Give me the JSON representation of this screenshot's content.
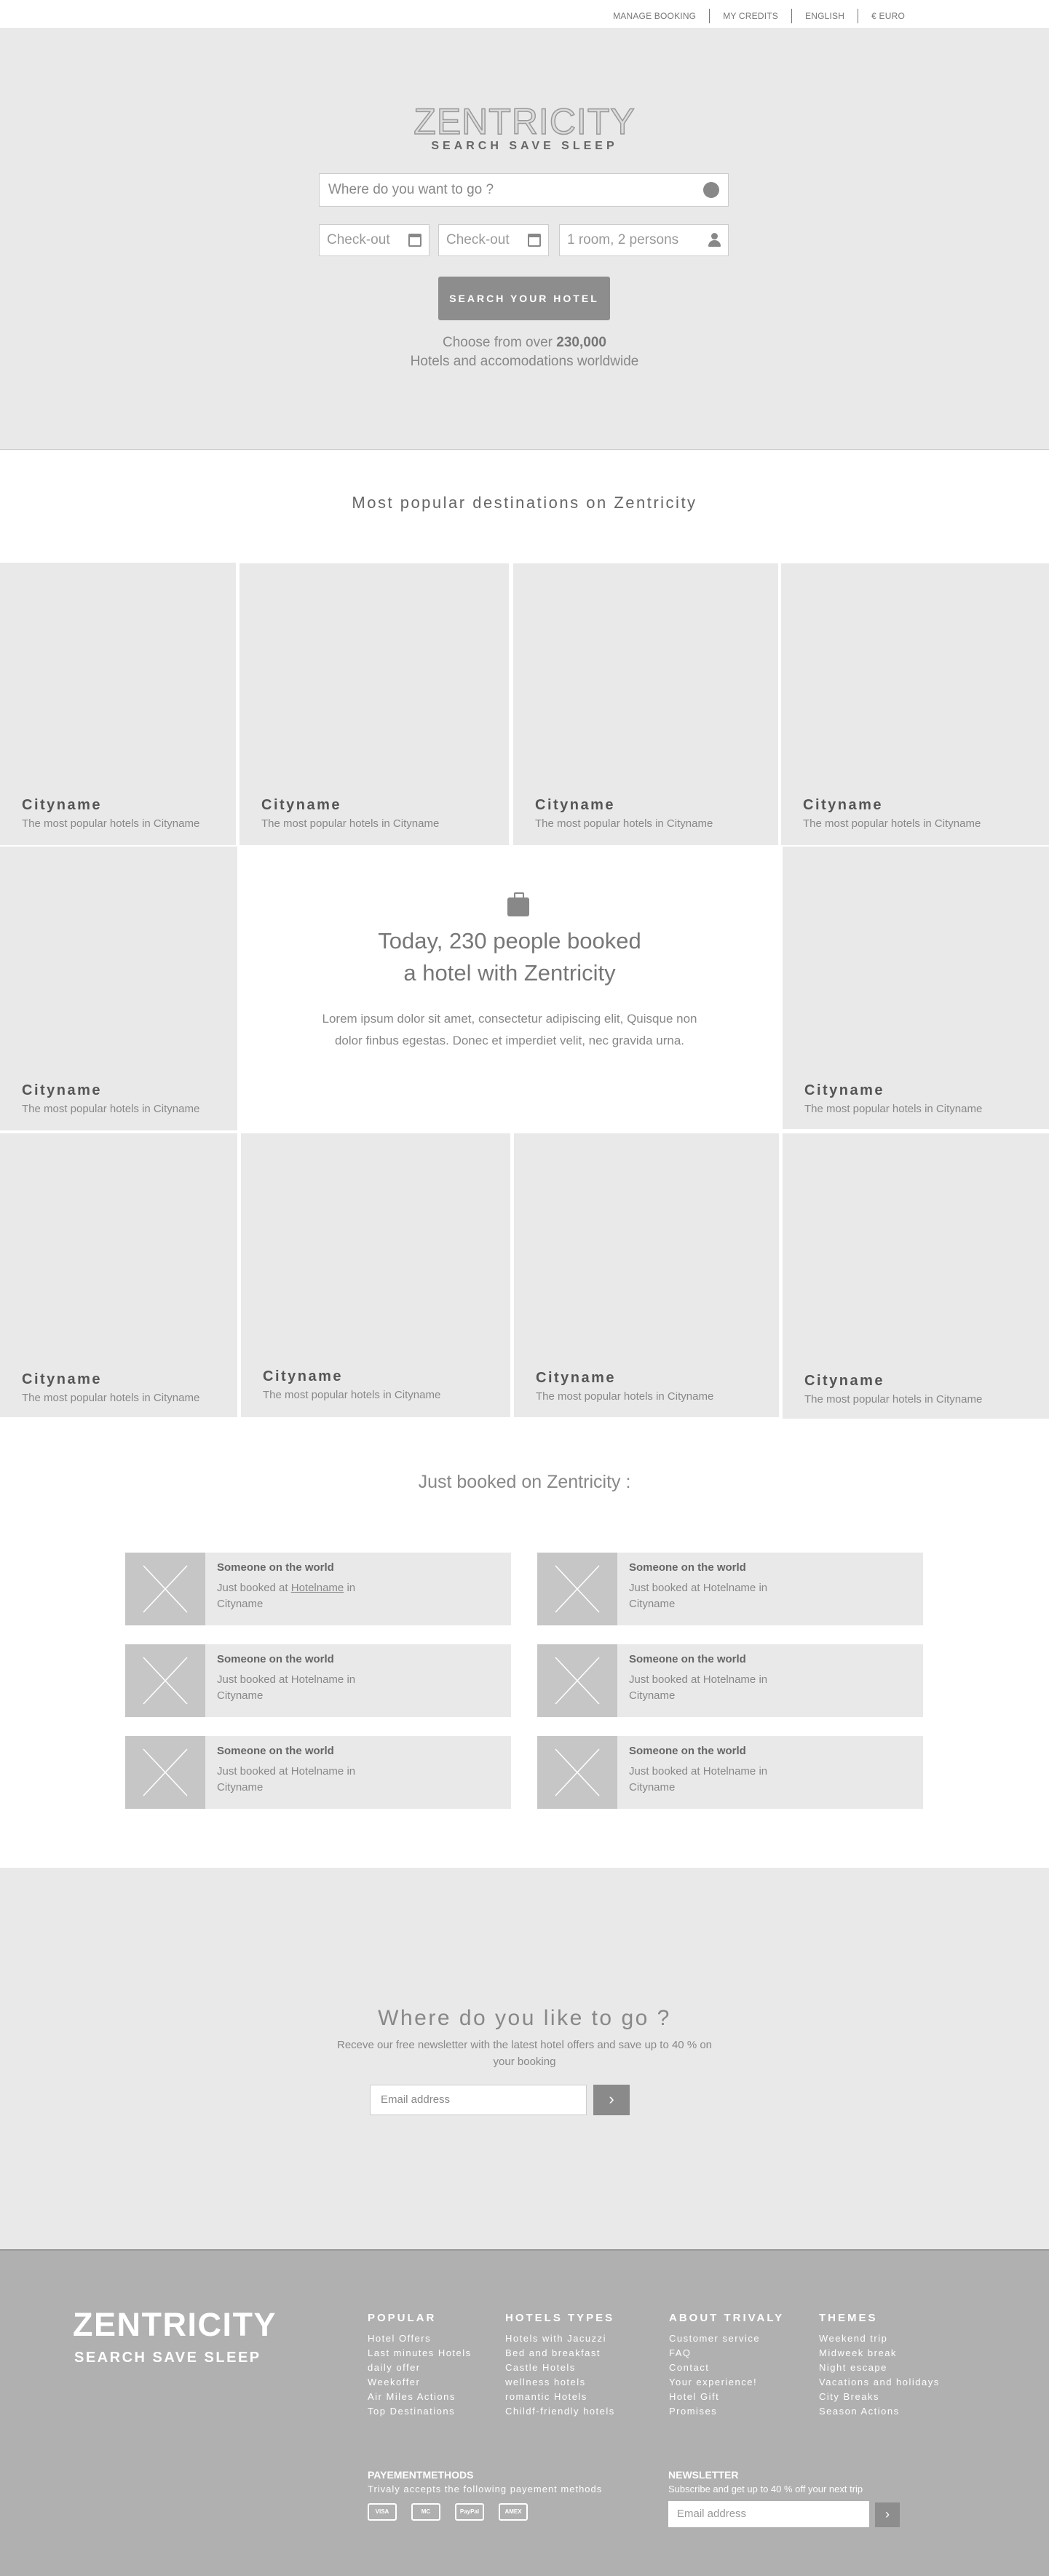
{
  "topnav": {
    "manage_booking": "MANAGE BOOKING",
    "my_credits": "MY CREDITS",
    "language": "ENGLISH",
    "currency": "€ EURO"
  },
  "hero": {
    "logo": "ZENTRICITY",
    "tagline": "SEARCH   SAVE   SLEEP",
    "where_placeholder": "Where do you want to go ?",
    "checkin_placeholder": "Check-out",
    "checkout_placeholder": "Check-out",
    "rooms_placeholder": "1 room, 2 persons",
    "search_button": "SEARCH YOUR HOTEL",
    "choose_prefix": "Choose from over ",
    "choose_count": "230,000",
    "choose_line2": "Hotels and accomodations worldwide"
  },
  "popular": {
    "title": "Most popular destinations on Zentricity",
    "city_name": "Cityname",
    "city_sub": "The most popular hotels in Cityname"
  },
  "center": {
    "line1": "Today, 230 people booked",
    "line2": "a hotel with Zentricity",
    "lorem": "Lorem ipsum dolor sit amet, consectetur adipiscing elit, Quisque non dolor finbus egestas. Donec et imperdiet velit, nec gravida urna."
  },
  "just_booked": {
    "title": "Just booked on Zentricity :",
    "who": "Someone on the world",
    "prefix": "Just booked at ",
    "hotel": "Hotelname",
    "suffix": " in Cityname"
  },
  "newsletter": {
    "title": "Where do you like to go ?",
    "sub": "Receve our free newsletter with the latest hotel offers and save up to 40 % on your booking",
    "placeholder": "Email address",
    "button": "›"
  },
  "footer": {
    "logo": "ZENTRICITY",
    "tag": "SEARCH SAVE SLEEP",
    "col1": {
      "title": "POPULAR",
      "items": [
        "Hotel Offers",
        "Last minutes Hotels",
        "daily offer",
        "Weekoffer",
        "Air Miles Actions",
        "Top Destinations"
      ]
    },
    "col2": {
      "title": "HOTELS TYPES",
      "items": [
        "Hotels with Jacuzzi",
        "Bed and breakfast",
        "Castle Hotels",
        "wellness hotels",
        "romantic Hotels",
        "Childf-friendly hotels"
      ]
    },
    "col3": {
      "title": "ABOUT TRIVALY",
      "items": [
        "Customer service",
        "FAQ",
        "Contact",
        "Your experience!",
        "Hotel Gift",
        "Promises"
      ]
    },
    "col4": {
      "title": "THEMES",
      "items": [
        "Weekend trip",
        "Midweek break",
        "Night escape",
        "Vacations and holidays",
        "City Breaks",
        "Season Actions"
      ]
    },
    "pay_title": "PAYEMENTMETHODS",
    "pay_sub": "Trivaly accepts the following payement methods",
    "pay_cards": [
      "VISA",
      "MC",
      "PayPal",
      "AMEX"
    ],
    "news_title": "NEWSLETTER",
    "news_sub": "Subscribe and get up to 40 % off your next trip",
    "news_placeholder": "Email address",
    "news_button": "›"
  }
}
